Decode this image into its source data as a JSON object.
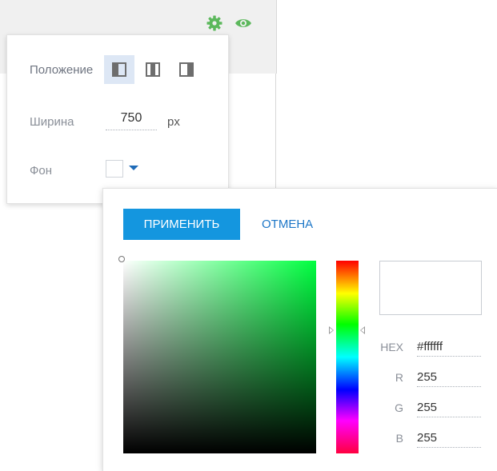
{
  "toolbar": {
    "settings_icon": "gear-icon",
    "preview_icon": "eye-icon",
    "accent": "#5cb85c"
  },
  "settings": {
    "position_label": "Положение",
    "width_label": "Ширина",
    "width_value": "750",
    "width_unit": "px",
    "background_label": "Фон",
    "position_options": [
      "layout-left-icon",
      "layout-center-icon",
      "layout-right-icon"
    ],
    "selected_position": 0
  },
  "picker": {
    "apply_label": "ПРИМЕНИТЬ",
    "cancel_label": "ОТМЕНА",
    "apply_color": "#1496df",
    "hue_color": "#00ff40",
    "hex_label": "HEX",
    "hex_value": "#ffffff",
    "r_label": "R",
    "r_value": "255",
    "g_label": "G",
    "g_value": "255",
    "b_label": "B",
    "b_value": "255"
  }
}
